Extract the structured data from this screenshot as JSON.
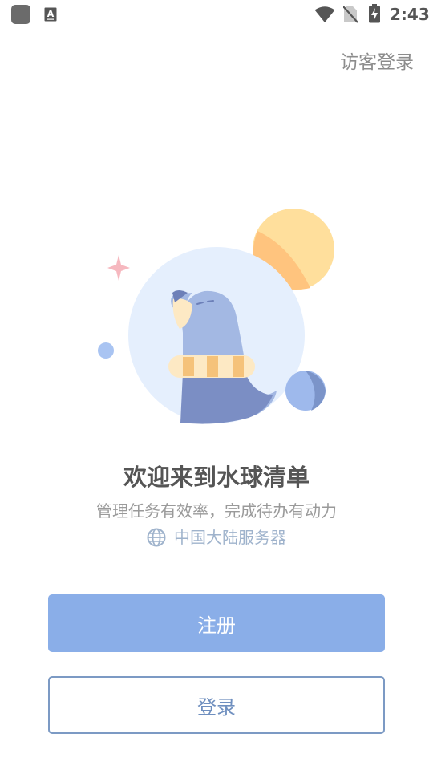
{
  "status_bar": {
    "time": "2:43",
    "icons": [
      "app-icon",
      "keyboard-a-icon",
      "wifi-icon",
      "no-sim-icon",
      "battery-charging-icon"
    ]
  },
  "header": {
    "guest_login_label": "访客登录"
  },
  "illustration": {
    "subject": "sea-lion-mascot",
    "colors": {
      "sun": "#ffdf9c",
      "sun_shade": "#ffc47e",
      "circle_bg": "#e5effd",
      "body": "#a3b8e3",
      "body_dark": "#7b8ec4",
      "scarf_light": "#fde9c4",
      "scarf_dark": "#f5c27a",
      "sparkle": "#f6b8bf",
      "ball": "#9eb9ec"
    }
  },
  "main": {
    "title": "欢迎来到水球清单",
    "subtitle": "管理任务有效率，完成待办有动力",
    "server_label": "中国大陆服务器"
  },
  "actions": {
    "register_label": "注册",
    "login_label": "登录"
  },
  "colors": {
    "primary": "#8aaee8",
    "outline": "#7c9ac4",
    "text_dark": "#555555",
    "text_muted": "#9a9a9a",
    "server_text": "#9fb3cc"
  }
}
